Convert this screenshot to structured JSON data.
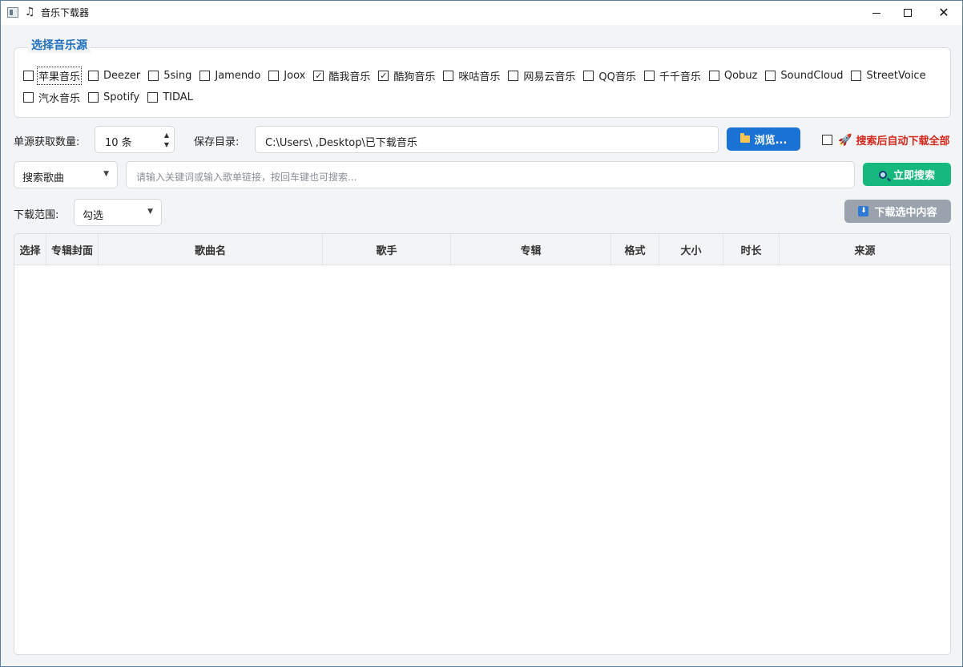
{
  "window": {
    "title": "音乐下载器"
  },
  "sources": {
    "group_title": "选择音乐源",
    "row1": [
      {
        "label": "苹果音乐",
        "checked": false,
        "focused": true
      },
      {
        "label": "Deezer",
        "checked": false
      },
      {
        "label": "5sing",
        "checked": false
      },
      {
        "label": "Jamendo",
        "checked": false
      },
      {
        "label": "Joox",
        "checked": false
      },
      {
        "label": "酷我音乐",
        "checked": true
      },
      {
        "label": "酷狗音乐",
        "checked": true
      },
      {
        "label": "咪咕音乐",
        "checked": false
      },
      {
        "label": "网易云音乐",
        "checked": false
      },
      {
        "label": "QQ音乐",
        "checked": false
      },
      {
        "label": "千千音乐",
        "checked": false
      },
      {
        "label": "Qobuz",
        "checked": false
      },
      {
        "label": "SoundCloud",
        "checked": false
      },
      {
        "label": "StreetVoice",
        "checked": false
      }
    ],
    "row2": [
      {
        "label": "汽水音乐",
        "checked": false
      },
      {
        "label": "Spotify",
        "checked": false
      },
      {
        "label": "TIDAL",
        "checked": false
      }
    ]
  },
  "settings": {
    "count_label": "单源获取数量:",
    "count_value": "10 条",
    "save_dir_label": "保存目录:",
    "save_dir_value": "C:\\Users\\      ,Desktop\\已下载音乐",
    "browse_label": "浏览...",
    "auto_download_label": "搜索后自动下载全部",
    "auto_download_checked": false
  },
  "search": {
    "mode_value": "搜索歌曲",
    "placeholder": "请输入关键词或输入歌单链接，按回车键也可搜索...",
    "button_label": "立即搜索"
  },
  "download": {
    "range_label": "下载范围:",
    "range_value": "勾选",
    "button_label": "下载选中内容"
  },
  "table": {
    "columns": [
      "选择",
      "专辑封面",
      "歌曲名",
      "歌手",
      "专辑",
      "格式",
      "大小",
      "时长",
      "来源"
    ],
    "rows": []
  },
  "colors": {
    "accent_blue": "#1a73d4",
    "accent_green": "#16b87e",
    "disabled_gray": "#9aa3ad",
    "group_title": "#1f6fbf",
    "warning_red": "#d4281c"
  }
}
